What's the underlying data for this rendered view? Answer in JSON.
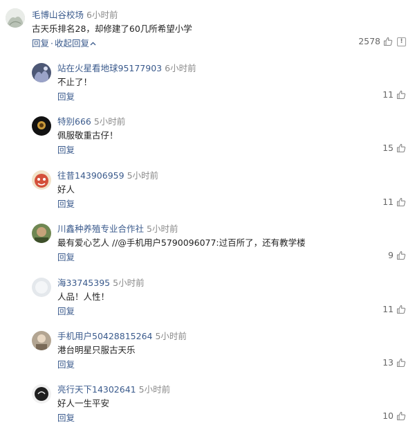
{
  "top_comment": {
    "username": "毛博山谷校场",
    "time": "6小时前",
    "content": "古天乐排名28，却修建了60几所希望小学",
    "reply_label": "回复",
    "separator": "·",
    "collapse_label": "收起回复",
    "likes": "2578",
    "report_icon": "!",
    "avatar_color": "#cfd6cf"
  },
  "replies": [
    {
      "username": "站在火星看地球95177903",
      "time": "6小时前",
      "content": "不止了！",
      "reply_label": "回复",
      "likes": "11",
      "avatar_color": "#5a6a8a"
    },
    {
      "username": "特别666",
      "time": "5小时前",
      "content": "佩服敬重古仔！",
      "reply_label": "回复",
      "likes": "15",
      "avatar_color": "#1a1a1a"
    },
    {
      "username": "往昔143906959",
      "time": "5小时前",
      "content": "好人",
      "reply_label": "回复",
      "likes": "11",
      "avatar_color": "#c8452e"
    },
    {
      "username": "川鑫种养殖专业合作社",
      "time": "5小时前",
      "content": "最有爱心艺人 //@手机用户5790096077:过百所了，还有教学楼",
      "reply_label": "回复",
      "likes": "9",
      "avatar_color": "#7a8b5a"
    },
    {
      "username": "海33745395",
      "time": "5小时前",
      "content": "人品！人性！",
      "reply_label": "回复",
      "likes": "11",
      "avatar_color": "#d8dde2"
    },
    {
      "username": "手机用户50428815264",
      "time": "5小时前",
      "content": "港台明星只服古天乐",
      "reply_label": "回复",
      "likes": "13",
      "avatar_color": "#a89a88"
    },
    {
      "username": "亮行天下14302641",
      "time": "5小时前",
      "content": "好人一生平安",
      "reply_label": "回复",
      "likes": "10",
      "avatar_color": "#2a2a2a"
    }
  ]
}
